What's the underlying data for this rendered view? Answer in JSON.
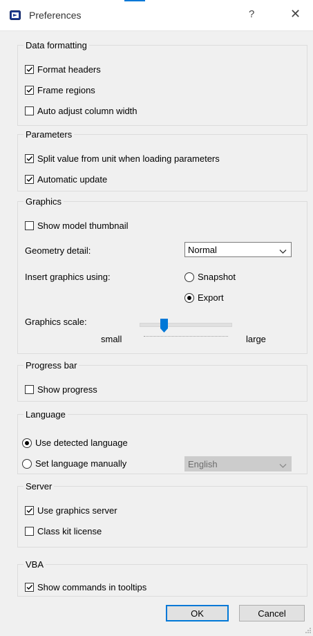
{
  "window": {
    "title": "Preferences",
    "help_glyph": "?",
    "close_glyph": "✕",
    "accent_color": "#0078d7"
  },
  "data_formatting": {
    "legend": "Data formatting",
    "format_headers": {
      "label": "Format headers",
      "checked": true
    },
    "frame_regions": {
      "label": "Frame regions",
      "checked": true
    },
    "auto_adjust": {
      "label": "Auto adjust column width",
      "checked": false
    }
  },
  "parameters": {
    "legend": "Parameters",
    "split_value": {
      "label": "Split value from unit when loading parameters",
      "checked": true
    },
    "automatic_update": {
      "label": "Automatic update",
      "checked": true
    }
  },
  "graphics": {
    "legend": "Graphics",
    "show_thumbnail": {
      "label": "Show model thumbnail",
      "checked": false
    },
    "geometry_detail_label": "Geometry detail:",
    "geometry_detail_value": "Normal",
    "insert_using_label": "Insert graphics using:",
    "snapshot_label": "Snapshot",
    "export_label": "Export",
    "insert_selected": "Export",
    "scale_label": "Graphics scale:",
    "scale_min_label": "small",
    "scale_max_label": "large",
    "scale_level": 0.27
  },
  "progress_bar": {
    "legend": "Progress bar",
    "show_progress": {
      "label": "Show progress",
      "checked": false
    }
  },
  "language": {
    "legend": "Language",
    "detected_label": "Use detected language",
    "manual_label": "Set language manually",
    "selected": "detected",
    "manual_value": "English"
  },
  "server": {
    "legend": "Server",
    "use_graphics_server": {
      "label": "Use graphics server",
      "checked": true
    },
    "class_kit_license": {
      "label": "Class kit license",
      "checked": false
    }
  },
  "vba": {
    "legend": "VBA",
    "show_commands": {
      "label": "Show commands in tooltips",
      "checked": true
    }
  },
  "buttons": {
    "ok_label": "OK",
    "cancel_label": "Cancel"
  }
}
